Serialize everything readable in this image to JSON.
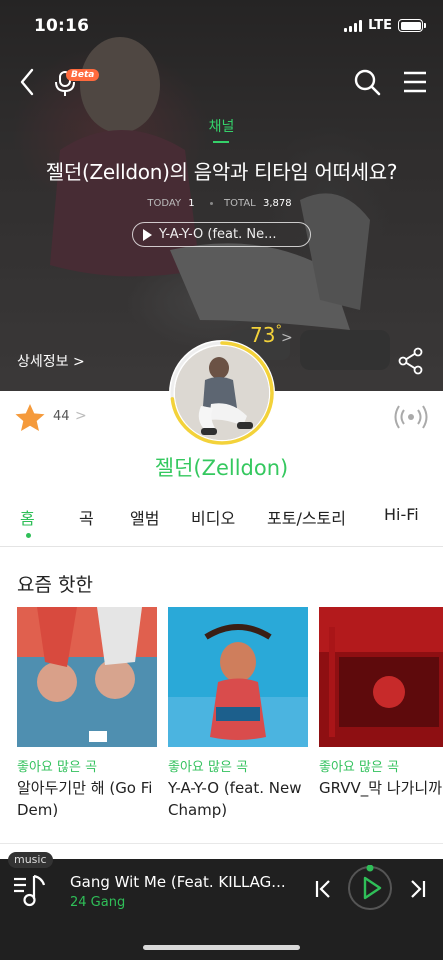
{
  "status_bar": {
    "time": "10:16",
    "network": "LTE"
  },
  "header": {
    "beta_label": "Beta",
    "channel_label": "채널",
    "title": "젤던(Zelldon)의 음악과 티타임 어떠세요?",
    "stats": {
      "today_label": "TODAY",
      "today_value": "1",
      "total_label": "TOTAL",
      "total_value": "3,878"
    },
    "featured_song": "Y-A-Y-O (feat. Ne...",
    "temperature": "73",
    "temperature_unit": "°",
    "detail_link": "상세정보 >"
  },
  "profile": {
    "fan_count": "44",
    "artist_name": "젤던(Zelldon)"
  },
  "tabs": [
    {
      "label": "홈",
      "active": true
    },
    {
      "label": "곡"
    },
    {
      "label": "앨범"
    },
    {
      "label": "비디오"
    },
    {
      "label": "포토/스토리"
    },
    {
      "label": "Hi-Fi"
    }
  ],
  "trending": {
    "title": "요즘 핫한",
    "items": [
      {
        "tag": "좋아요 많은 곡",
        "title": "알아두기만 해 (Go Fi Dem)"
      },
      {
        "tag": "좋아요 많은 곡",
        "title": "Y-A-Y-O (feat. New Champ)"
      },
      {
        "tag": "좋아요 많은 곡",
        "title": "GRVV_막 나가니까"
      }
    ]
  },
  "player": {
    "tag": "music",
    "title": "Gang Wit Me (Feat. KILLAG...",
    "artist": "24 Gang"
  },
  "colors": {
    "accent_green": "#2fbf58",
    "temperature_yellow": "#f3d23a",
    "star_orange": "#f59a3b",
    "beta_orange": "#ff6a3d"
  }
}
